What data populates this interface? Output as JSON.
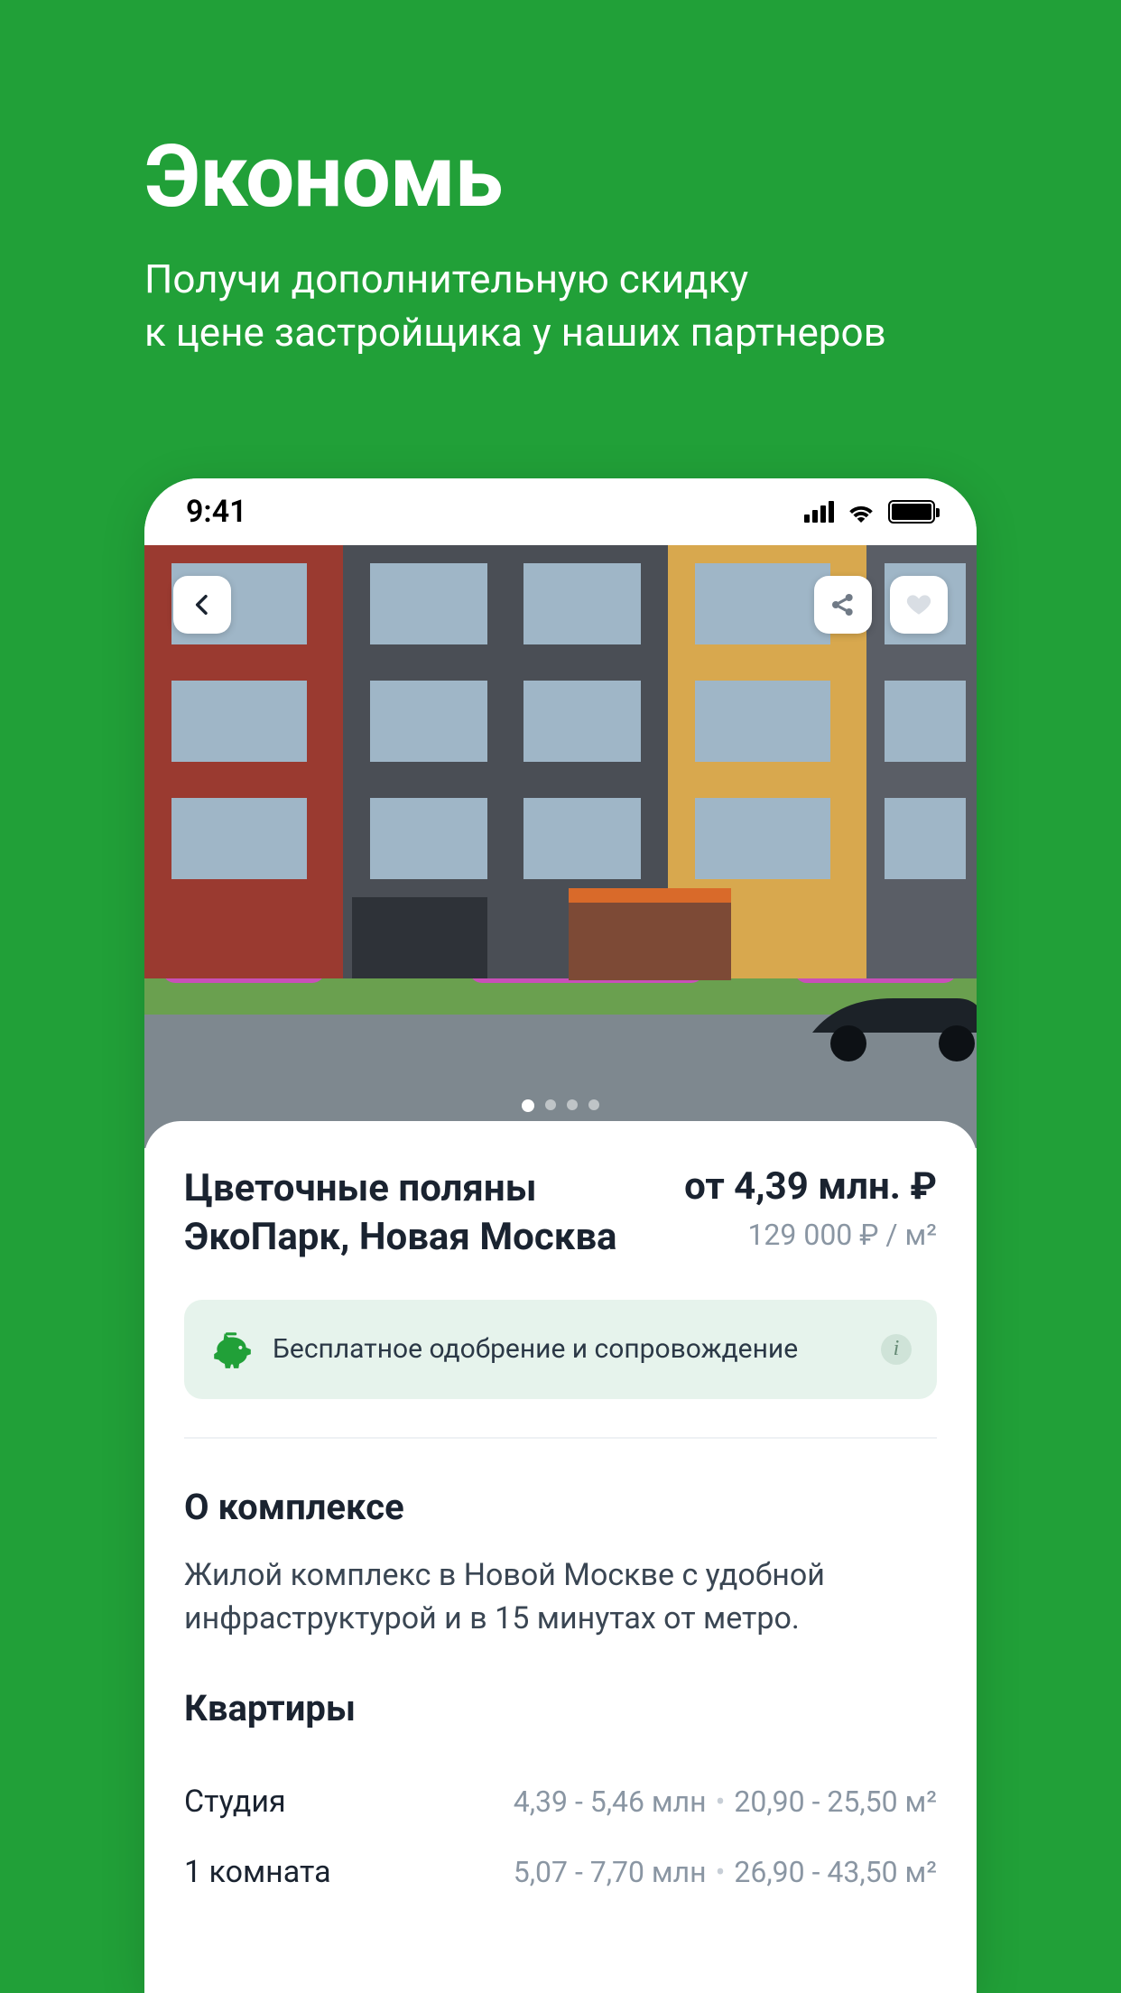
{
  "promo": {
    "headline": "Экономь",
    "sub_line1": "Получи дополнительную скидку",
    "sub_line2": "к цене застройщика у наших партнеров"
  },
  "statusbar": {
    "time": "9:41"
  },
  "carousel": {
    "count": 4,
    "active": 0
  },
  "property": {
    "title_line1": "Цветочные поляны",
    "title_line2": "ЭкоПарк, Новая Москва",
    "price_main": "от 4,39 млн. ₽",
    "price_sub": "129 000 ₽ / м²"
  },
  "banner": {
    "text": "Бесплатное одобрение и сопровождение"
  },
  "about": {
    "heading": "О комплексе",
    "text": "Жилой комплекс в Новой Москве с удобной инфраструктурой и в 15 минутах от метро."
  },
  "apartments": {
    "heading": "Квартиры",
    "rows": [
      {
        "name": "Студия",
        "price": "4,39 - 5,46 млн",
        "area": "20,90 - 25,50 м²"
      },
      {
        "name": "1 комната",
        "price": "5,07 - 7,70 млн",
        "area": "26,90 - 43,50 м²"
      }
    ]
  }
}
